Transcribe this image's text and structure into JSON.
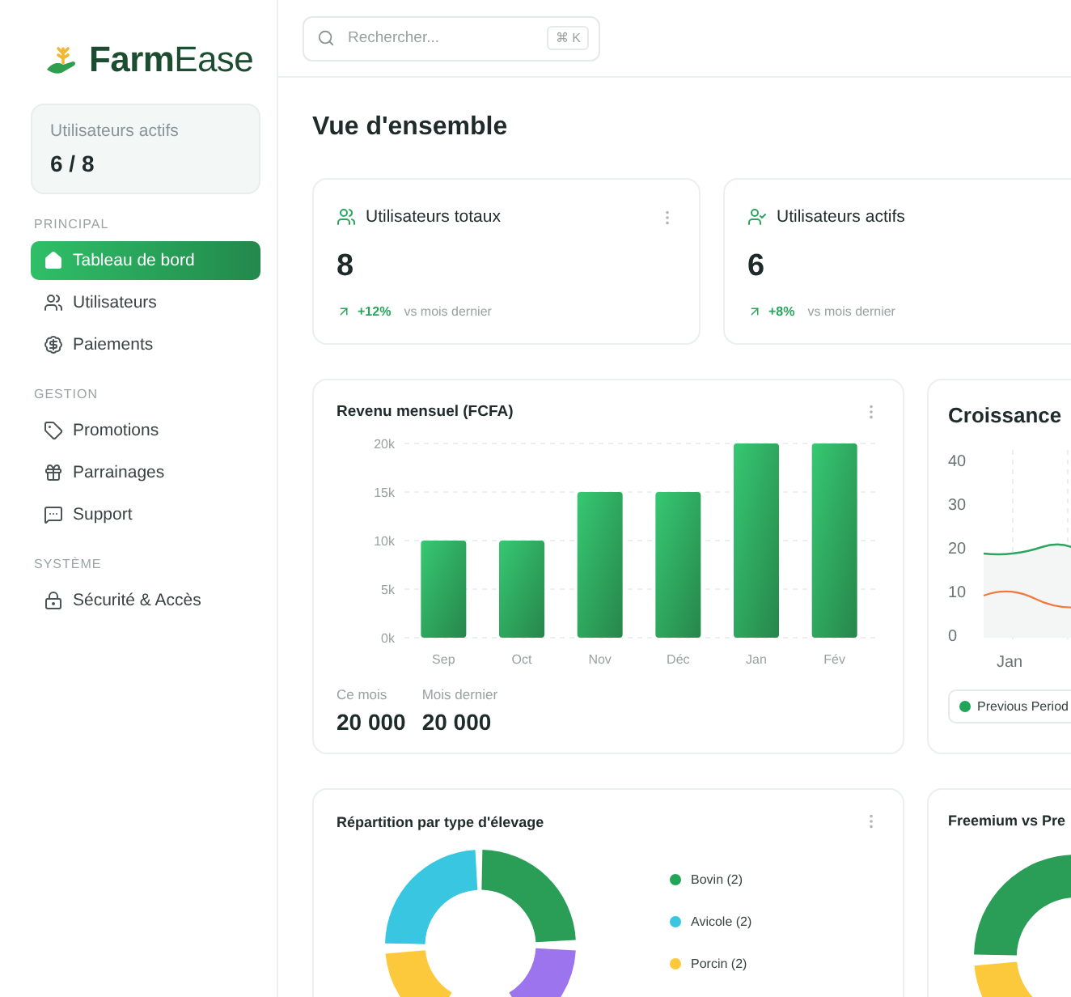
{
  "brand": {
    "name": "**Farm**Ease"
  },
  "sidebar": {
    "summary": {
      "label": "Utilisateurs actifs",
      "value": "6 / 8"
    },
    "sections": [
      {
        "label": "PRINCIPAL",
        "items": [
          {
            "label": "Tableau de bord",
            "selected": true
          },
          {
            "label": "Utilisateurs",
            "selected": false
          },
          {
            "label": "Paiements",
            "selected": false
          }
        ]
      },
      {
        "label": "GESTION",
        "items": [
          {
            "label": "Promotions",
            "selected": false
          },
          {
            "label": "Parrainages",
            "selected": false
          },
          {
            "label": "Support",
            "selected": false
          }
        ]
      },
      {
        "label": "SYSTÈME",
        "items": [
          {
            "label": "Sécurité & Accès",
            "selected": false
          }
        ]
      }
    ]
  },
  "search": {
    "placeholder": "Rechercher...",
    "shortcut": "⌘ K"
  },
  "page_title": "Vue d'ensemble",
  "stats": [
    {
      "title": "Utilisateurs totaux",
      "value": "8",
      "change": "+12%",
      "note": "vs mois dernier"
    },
    {
      "title": "Utilisateurs actifs",
      "value": "6",
      "change": "+8%",
      "note": "vs mois dernier"
    }
  ],
  "revenue": {
    "title": "Revenu mensuel (FCFA)",
    "chart_data": {
      "type": "bar",
      "categories": [
        "Sep",
        "Oct",
        "Nov",
        "Déc",
        "Jan",
        "Fév"
      ],
      "values": [
        10000,
        10000,
        15000,
        15000,
        20000,
        20000
      ],
      "ylim": [
        0,
        20000
      ],
      "grid": true,
      "yticks": [
        {
          "value": 0,
          "label": "0k"
        },
        {
          "value": 5000,
          "label": "5k"
        },
        {
          "value": 10000,
          "label": "10k"
        },
        {
          "value": 15000,
          "label": "15k"
        },
        {
          "value": 20000,
          "label": "20k"
        }
      ]
    },
    "totals": [
      {
        "label": "Ce mois",
        "value": "20 000"
      },
      {
        "label": "Mois dernier",
        "value": "20 000"
      }
    ]
  },
  "growth": {
    "title": "Croissance",
    "y_axis_labels": [
      "40",
      "30",
      "20",
      "10",
      "0"
    ],
    "x_axis_labels": [
      "Jan"
    ],
    "legend": [
      {
        "label": "Previous Period",
        "color": "#22a559"
      }
    ]
  },
  "breakdown": {
    "title": "Répartition par type d'élevage",
    "legend": [
      {
        "label": "Bovin (2)",
        "color": "#22a559"
      },
      {
        "label": "Avicole (2)",
        "color": "#38c6e0"
      },
      {
        "label": "Porcin (2)",
        "color": "#fcc93c"
      }
    ]
  },
  "plans": {
    "title": "Freemium vs Pre"
  }
}
